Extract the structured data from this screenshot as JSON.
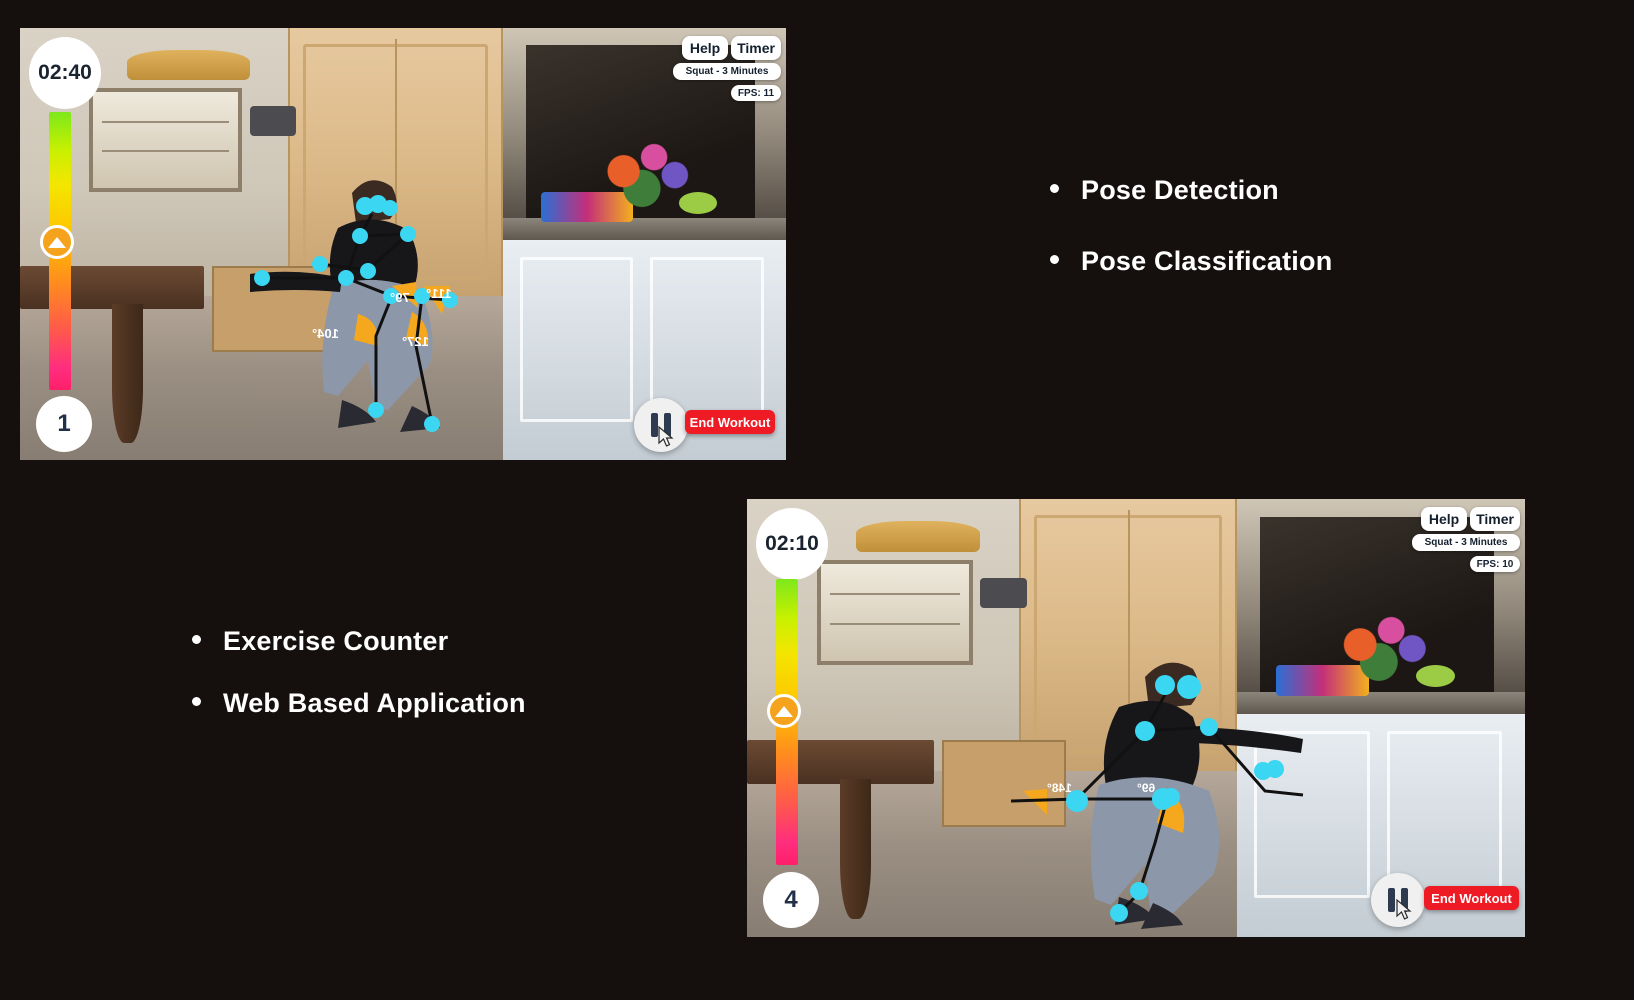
{
  "page": {
    "background_color": "#150f0d",
    "text_color": "#ffffff"
  },
  "feature_list_right": {
    "items": [
      {
        "label": "Pose Detection"
      },
      {
        "label": " Pose Classification"
      }
    ]
  },
  "feature_list_left": {
    "items": [
      {
        "label": "Exercise Counter"
      },
      {
        "label": "Web Based Application"
      }
    ]
  },
  "video_top": {
    "timer": "02:40",
    "rep_count": "1",
    "help_label": "Help",
    "timer_label": "Timer",
    "workout_label": "Squat - 3 Minutes",
    "fps_label": "FPS: 11",
    "end_workout_label": "End Workout",
    "pause_icon": "pause-icon",
    "gradient_knob_icon": "triangle-up-icon",
    "accent_color": "#ee1b24",
    "knob_color": "#f5a21c",
    "keypoint_color": "#3ad6f2",
    "angle_arc_color": "#f5a81e",
    "angles": [
      "79°",
      "111°",
      "104°",
      "127°"
    ]
  },
  "video_bottom": {
    "timer": "02:10",
    "rep_count": "4",
    "help_label": "Help",
    "timer_label": "Timer",
    "workout_label": "Squat - 3 Minutes",
    "fps_label": "FPS: 10",
    "end_workout_label": "End Workout",
    "pause_icon": "pause-icon",
    "gradient_knob_icon": "triangle-up-icon",
    "accent_color": "#ee1b24",
    "knob_color": "#f5a21c",
    "keypoint_color": "#3ad6f2",
    "angle_arc_color": "#f5a81e",
    "angles": [
      "148°",
      "69°"
    ]
  }
}
